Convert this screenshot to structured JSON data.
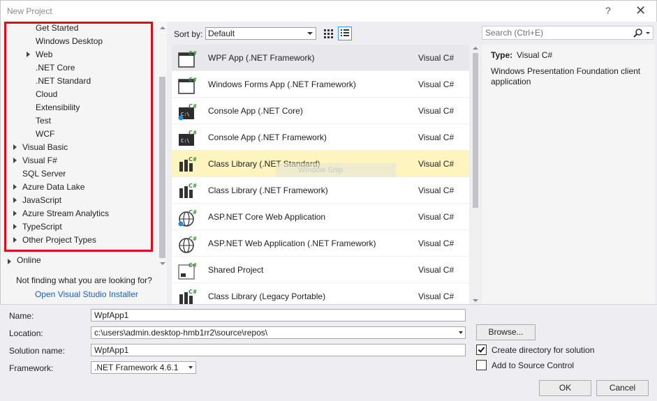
{
  "window": {
    "title": "New Project",
    "help": "?",
    "close": "✕"
  },
  "templates_tree": [
    {
      "label": "Get Started",
      "level": 1,
      "caret": false
    },
    {
      "label": "Windows Desktop",
      "level": 1,
      "caret": false
    },
    {
      "label": "Web",
      "level": 1,
      "caret": true
    },
    {
      "label": ".NET Core",
      "level": 1,
      "caret": false
    },
    {
      "label": ".NET Standard",
      "level": 1,
      "caret": false
    },
    {
      "label": "Cloud",
      "level": 1,
      "caret": false
    },
    {
      "label": "Extensibility",
      "level": 1,
      "caret": false
    },
    {
      "label": "Test",
      "level": 1,
      "caret": false
    },
    {
      "label": "WCF",
      "level": 1,
      "caret": false
    },
    {
      "label": "Visual Basic",
      "level": 0,
      "caret": true
    },
    {
      "label": "Visual F#",
      "level": 0,
      "caret": true
    },
    {
      "label": "SQL Server",
      "level": 0,
      "caret": false
    },
    {
      "label": "Azure Data Lake",
      "level": 0,
      "caret": true
    },
    {
      "label": "JavaScript",
      "level": 0,
      "caret": true
    },
    {
      "label": "Azure Stream Analytics",
      "level": 0,
      "caret": true
    },
    {
      "label": "TypeScript",
      "level": 0,
      "caret": true
    },
    {
      "label": "Other Project Types",
      "level": 0,
      "caret": true
    }
  ],
  "online": {
    "label": "Online"
  },
  "not_finding": "Not finding what you are looking for?",
  "installer_link": "Open Visual Studio Installer",
  "toolbar": {
    "sort_label": "Sort by:",
    "sort_value": "Default"
  },
  "search": {
    "placeholder": "Search (Ctrl+E)"
  },
  "projects": [
    {
      "name": "WPF App (.NET Framework)",
      "lang": "Visual C#",
      "icon": "wpf-app-icon",
      "state": "selected"
    },
    {
      "name": "Windows Forms App (.NET Framework)",
      "lang": "Visual C#",
      "icon": "windows-forms-icon",
      "state": ""
    },
    {
      "name": "Console App (.NET Core)",
      "lang": "Visual C#",
      "icon": "console-core-icon",
      "state": ""
    },
    {
      "name": "Console App (.NET Framework)",
      "lang": "Visual C#",
      "icon": "console-framework-icon",
      "state": ""
    },
    {
      "name": "Class Library (.NET Standard)",
      "lang": "Visual C#",
      "icon": "class-library-standard-icon",
      "state": "hover"
    },
    {
      "name": "Class Library (.NET Framework)",
      "lang": "Visual C#",
      "icon": "class-library-framework-icon",
      "state": ""
    },
    {
      "name": "ASP.NET Core Web Application",
      "lang": "Visual C#",
      "icon": "aspnet-core-icon",
      "state": ""
    },
    {
      "name": "ASP.NET Web Application (.NET Framework)",
      "lang": "Visual C#",
      "icon": "aspnet-web-icon",
      "state": ""
    },
    {
      "name": "Shared Project",
      "lang": "Visual C#",
      "icon": "shared-project-icon",
      "state": ""
    },
    {
      "name": "Class Library (Legacy Portable)",
      "lang": "Visual C#",
      "icon": "class-library-portable-icon",
      "state": ""
    }
  ],
  "watermark": "Window Snip",
  "details": {
    "type_label": "Type:",
    "type_value": "Visual C#",
    "description": "Windows Presentation Foundation client application"
  },
  "form": {
    "name_label": "Name:",
    "name_value": "WpfApp1",
    "location_label": "Location:",
    "location_value": "c:\\users\\admin.desktop-hmb1rr2\\source\\repos\\",
    "solution_label": "Solution name:",
    "solution_value": "WpfApp1",
    "framework_label": "Framework:",
    "framework_value": ".NET Framework 4.6.1",
    "browse": "Browse...",
    "create_dir_label": "Create directory for solution",
    "create_dir_checked": true,
    "source_control_label": "Add to Source Control",
    "source_control_checked": false,
    "ok": "OK",
    "cancel": "Cancel"
  },
  "colors": {
    "accent": "#3399ff",
    "highlight_box": "#d8101c",
    "link": "#1a5fb4",
    "csharp_green": "#68217a"
  }
}
